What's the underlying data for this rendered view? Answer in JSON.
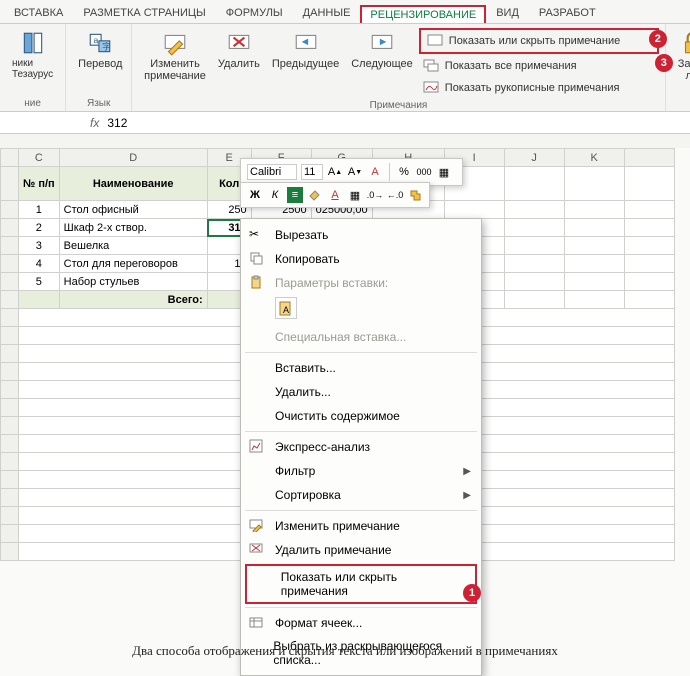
{
  "tabs": {
    "insert": "ВСТАВКА",
    "pagelayout": "РАЗМЕТКА СТРАНИЦЫ",
    "formulas": "ФОРМУЛЫ",
    "data": "ДАННЫЕ",
    "review": "РЕЦЕНЗИРОВАНИЕ",
    "view": "ВИД",
    "developer": "РАЗРАБОТ"
  },
  "ribbon": {
    "thesaurus": "Тезаурус",
    "translate": "Перевод",
    "edit_comment": "Изменить\nпримечание",
    "delete": "Удалить",
    "previous": "Предыдущее",
    "next": "Следующее",
    "show_hide_comment": "Показать или скрыть примечание",
    "show_all": "Показать все примечания",
    "show_ink": "Показать рукописные примечания",
    "protect": "Защи\nли",
    "grp_lang": "Язык",
    "grp_comments": "Примечания",
    "grp_proof_partial": "ние",
    "thesaurus_prefix": "ники"
  },
  "fx": {
    "symbol": "fx",
    "value": "312"
  },
  "columns": {
    "C": "C",
    "D": "D",
    "E": "E",
    "F": "F",
    "G": "G",
    "H": "H",
    "I": "I",
    "J": "J",
    "K": "K"
  },
  "table": {
    "hdr_num": "№ п/п",
    "hdr_name": "Наименование",
    "hdr_qty": "Кол",
    "rows": [
      {
        "n": "1",
        "name": "Стол офисный",
        "qty": "250"
      },
      {
        "n": "2",
        "name": "Шкаф 2-х створ.",
        "qty": "312"
      },
      {
        "n": "3",
        "name": "Вешелка",
        "qty": ""
      },
      {
        "n": "4",
        "name": "Стол для переговоров",
        "qty": "14"
      },
      {
        "n": "5",
        "name": "Набор стульев",
        "qty": ""
      }
    ],
    "total_label": "Всего:",
    "f_val": "2500",
    "g_val": "025000,00"
  },
  "mini": {
    "font": "Calibri",
    "size": "11",
    "bold": "Ж",
    "italic": "К"
  },
  "ctx": {
    "cut": "Вырезать",
    "copy": "Копировать",
    "paste_opts": "Параметры вставки:",
    "paste_special": "Специальная вставка...",
    "insert": "Вставить...",
    "delete": "Удалить...",
    "clear": "Очистить содержимое",
    "quick": "Экспресс-анализ",
    "filter": "Фильтр",
    "sort": "Сортировка",
    "edit_comment": "Изменить примечание",
    "delete_comment": "Удалить примечание",
    "show_hide": "Показать или скрыть примечания",
    "format": "Формат ячеек...",
    "dropdown": "Выбрать из раскрывающегося списка..."
  },
  "markers": {
    "m1": "1",
    "m2": "2",
    "m3": "3"
  },
  "caption": "Два способа отображения и скрытия текста или изображений в примечаниях"
}
